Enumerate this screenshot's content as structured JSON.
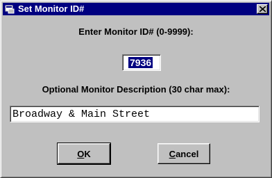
{
  "window": {
    "title": "Set Monitor ID#",
    "titlebar_color": "#000080",
    "face_color": "#c0c0c0"
  },
  "form": {
    "id_label": "Enter Monitor ID# (0-9999):",
    "id_value": "7936",
    "desc_label": "Optional Monitor Description (30 char max):",
    "desc_value": "Broadway & Main Street"
  },
  "buttons": {
    "ok_mnemonic": "O",
    "ok_rest": "K",
    "cancel_mnemonic": "C",
    "cancel_rest": "ancel"
  },
  "icons": {
    "app": "window-app-icon",
    "close": "close-x-icon"
  }
}
